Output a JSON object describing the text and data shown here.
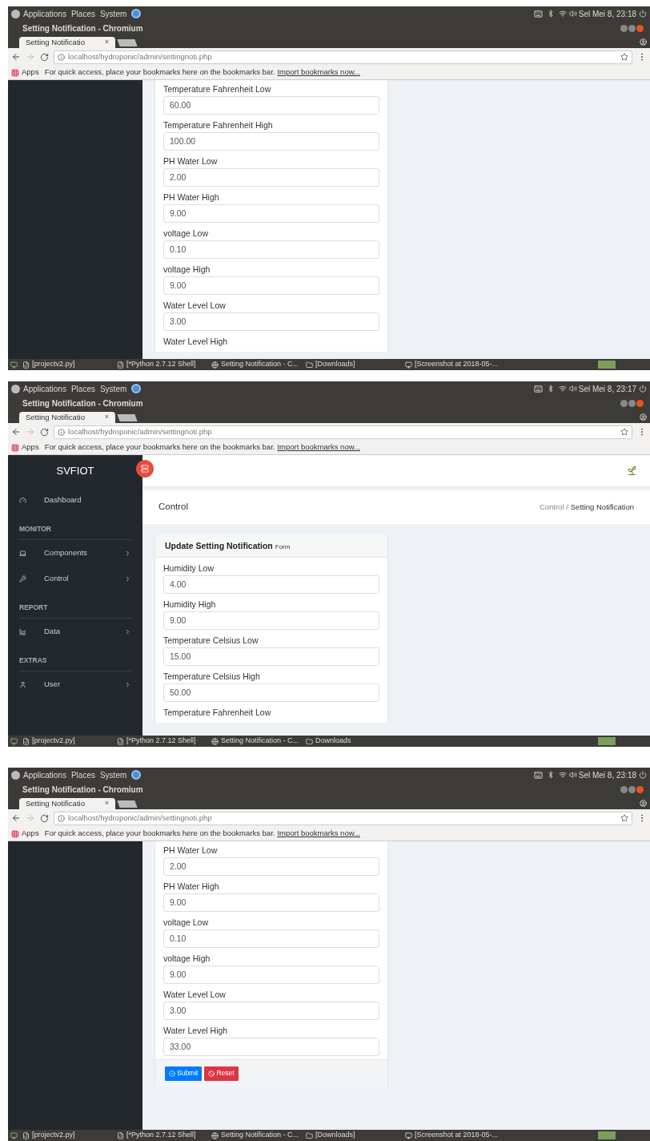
{
  "screenshots": [
    {
      "topbar": {
        "menus": [
          "Applications",
          "Places",
          "System"
        ],
        "clock": "Sel Mei 8, 23:18"
      },
      "window_title": "Setting Notification - Chromium",
      "tab": {
        "title": "Setting Notificatio",
        "close": "×"
      },
      "url": "localhost/hydroponic/admin/settingnoti.php",
      "bookmarks": {
        "apps": "Apps",
        "hint": "For quick access, place your bookmarks here on the bookmarks bar.",
        "link": "Import bookmarks now..."
      },
      "fields": [
        {
          "label": "Temperature Fahrenheit Low",
          "value": "60.00"
        },
        {
          "label": "Temperature Fahrenheit High",
          "value": "100.00"
        },
        {
          "label": "PH Water Low",
          "value": "2.00"
        },
        {
          "label": "PH Water High",
          "value": "9.00"
        },
        {
          "label": "voltage Low",
          "value": "0.10"
        },
        {
          "label": "voltage High",
          "value": "9.00"
        },
        {
          "label": "Water Level Low",
          "value": "3.00"
        },
        {
          "label": "Water Level High"
        }
      ],
      "taskbar": [
        "[projectv2.py]",
        "[*Python 2.7.12 Shell]",
        "Setting Notification - C...",
        "[Downloads]",
        "[Screenshot at 2018-05-..."
      ]
    },
    {
      "topbar": {
        "menus": [
          "Applications",
          "Places",
          "System"
        ],
        "clock": "Sel Mei 8, 23:17"
      },
      "window_title": "Setting Notification - Chromium",
      "tab": {
        "title": "Setting Notificatio",
        "close": "×"
      },
      "url": "localhost/hydroponic/admin/settingnoti.php",
      "bookmarks": {
        "apps": "Apps",
        "hint": "For quick access, place your bookmarks here on the bookmarks bar.",
        "link": "Import bookmarks now..."
      },
      "brand": "SVFIOT",
      "page_title": "Control",
      "breadcrumb": [
        "Control /",
        "Setting Notification"
      ],
      "sidebar": [
        {
          "kind": "link",
          "label": "Dashboard",
          "submenu": false
        },
        {
          "kind": "heading",
          "label": "MONITOR"
        },
        {
          "kind": "link",
          "label": "Components",
          "submenu": true
        },
        {
          "kind": "link",
          "label": "Control",
          "submenu": true
        },
        {
          "kind": "heading",
          "label": "REPORT"
        },
        {
          "kind": "link",
          "label": "Data",
          "submenu": true
        },
        {
          "kind": "heading",
          "label": "EXTRAS"
        },
        {
          "kind": "link",
          "label": "User",
          "submenu": true
        }
      ],
      "card_title": {
        "main": "Update Setting Notification",
        "sub": "Form"
      },
      "fields": [
        {
          "label": "Humidity Low",
          "value": "4.00"
        },
        {
          "label": "Humidity High",
          "value": "9.00"
        },
        {
          "label": "Temperature Celsius Low",
          "value": "15.00"
        },
        {
          "label": "Temperature Celsius High",
          "value": "50.00"
        },
        {
          "label": "Temperature Fahrenheit Low"
        }
      ],
      "taskbar": [
        "[projectv2.py]",
        "[*Python 2.7.12 Shell]",
        "Setting Notification - C...",
        "Downloads"
      ]
    },
    {
      "topbar": {
        "menus": [
          "Applications",
          "Places",
          "System"
        ],
        "clock": "Sel Mei 8, 23:18"
      },
      "window_title": "Setting Notification - Chromium",
      "tab": {
        "title": "Setting Notificatio",
        "close": "×"
      },
      "url": "localhost/hydroponic/admin/settingnoti.php",
      "bookmarks": {
        "apps": "Apps",
        "hint": "For quick access, place your bookmarks here on the bookmarks bar.",
        "link": "Import bookmarks now..."
      },
      "fields": [
        {
          "label": "PH Water Low",
          "value": "2.00"
        },
        {
          "label": "PH Water High",
          "value": "9.00"
        },
        {
          "label": "voltage Low",
          "value": "0.10"
        },
        {
          "label": "voltage High",
          "value": "9.00"
        },
        {
          "label": "Water Level Low",
          "value": "3.00"
        },
        {
          "label": "Water Level High",
          "value": "33.00"
        }
      ],
      "buttons": [
        {
          "kind": "submit",
          "label": "Submit"
        },
        {
          "kind": "reset",
          "label": "Reset"
        }
      ],
      "taskbar": [
        "[projectv2.py]",
        "[*Python 2.7.12 Shell]",
        "Setting Notification - C...",
        "[Downloads]",
        "[Screenshot at 2018-05-..."
      ]
    }
  ]
}
